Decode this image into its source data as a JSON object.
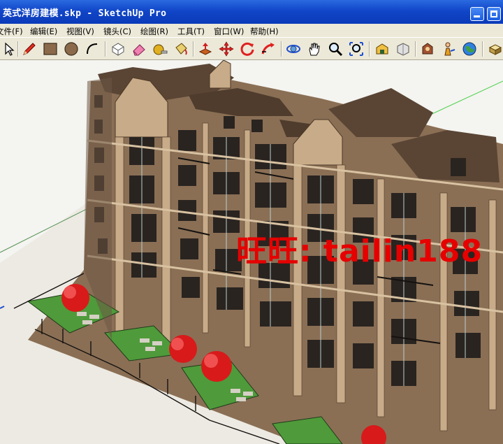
{
  "window": {
    "title": "英式洋房建模.skp - SketchUp Pro"
  },
  "menu": {
    "items": [
      {
        "label": "文件(F)"
      },
      {
        "label": "编辑(E)"
      },
      {
        "label": "视图(V)"
      },
      {
        "label": "镜头(C)"
      },
      {
        "label": "绘图(R)"
      },
      {
        "label": "工具(T)"
      },
      {
        "label": "窗口(W)"
      },
      {
        "label": "帮助(H)"
      }
    ]
  },
  "toolbar": {
    "tools": [
      "select-icon",
      "pencil-icon",
      "rectangle-icon",
      "circle-icon",
      "arc-icon",
      "eraser-icon",
      "paint-icon",
      "tape-measure-icon",
      "paint-bucket-icon",
      "push-pull-icon",
      "move-icon",
      "rotate-icon",
      "follow-me-icon",
      "orbit-icon",
      "pan-icon",
      "zoom-icon",
      "zoom-extents-icon",
      "warehouse-icon",
      "share-model-icon",
      "component-icon",
      "position-camera-icon",
      "globe-icon",
      "extension-icon"
    ]
  },
  "viewport": {
    "watermark": "旺旺: tailin188"
  }
}
